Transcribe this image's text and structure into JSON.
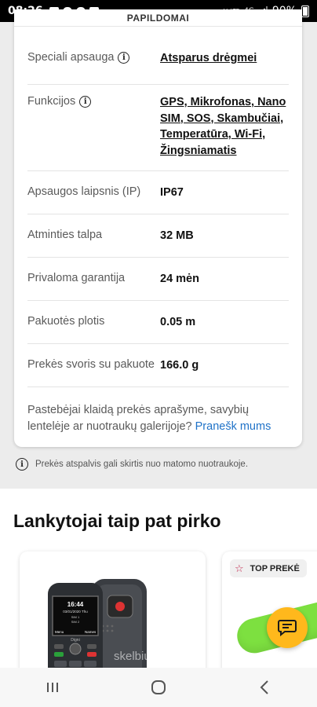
{
  "status_bar": {
    "time": "08:26",
    "network_top": "VoLTE",
    "network_gen": "4G",
    "battery": "90%"
  },
  "specs": {
    "header": "PAPILDOMAI",
    "rows": [
      {
        "label": "Speciali apsauga",
        "value": "Atsparus drėgmei"
      },
      {
        "label": "Funkcijos",
        "value": "GPS, Mikrofonas, Nano SIM, SOS, Skambučiai, Temperatūra, Wi-Fi, Žingsniamatis"
      },
      {
        "label": "Apsaugos laipsnis (IP)",
        "value": "IP67"
      },
      {
        "label": "Atminties talpa",
        "value": "32 MB"
      },
      {
        "label": "Privaloma garantija",
        "value": "24 mėn"
      },
      {
        "label": "Pakuotės plotis",
        "value": "0.05 m"
      },
      {
        "label": "Prekės svoris su pakuote",
        "value": "166.0 g"
      }
    ],
    "report_text": "Pastebėjai klaidą prekės aprašyme, savybių lentelėje ar nuotraukų galerijoje?",
    "report_link": "Pranešk mums"
  },
  "note": "Prekės atspalvis gali skirtis nuo matomo nuotraukoje.",
  "recommendations": {
    "title": "Lankytojai taip pat pirko",
    "phone_screen": {
      "time": "16:44",
      "date": "03/01/2020 Thu",
      "sim1": "SIM 1",
      "sim2": "SIM 2",
      "menu": "Menu",
      "names": "Names",
      "brand": "Digni"
    },
    "watermark": "skelbiu.lt",
    "badge": "TOP PREKĖ"
  },
  "icons": {
    "chat": "chat-icon",
    "info": "info-icon",
    "star": "star-icon"
  },
  "colors": {
    "link": "#1f72c8",
    "chat": "#ffb81c",
    "badge_star": "#c0284e",
    "tube": "#7de040"
  }
}
